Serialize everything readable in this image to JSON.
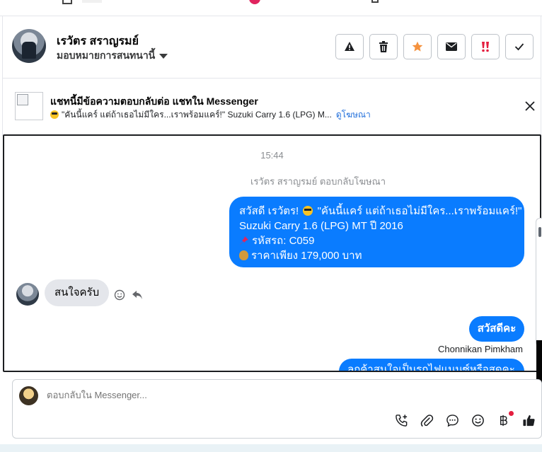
{
  "header": {
    "contact_name": "เรวัตร สราญรมย์",
    "assign_label": "มอบหมายการสนทนานี้",
    "actions": [
      {
        "icon": "warning-icon",
        "color": "#1c1e21"
      },
      {
        "icon": "trash-icon",
        "color": "#1c1e21"
      },
      {
        "icon": "star-icon",
        "color": "#f5923e"
      },
      {
        "icon": "envelope-icon",
        "color": "#1c1e21"
      },
      {
        "icon": "double-exclamation-icon",
        "color": "#e41e3f"
      },
      {
        "icon": "check-icon",
        "color": "#1c1e21"
      }
    ]
  },
  "ad": {
    "title": "แชทนี้มีข้อความตอบกลับต่อ แชทใน Messenger",
    "subtitle": "\"คันนี้แคร์ แต่ถ้าเธอไม่มีใคร...เราพร้อมแคร์!\" Suzuki Carry 1.6 (LPG) M...",
    "link_label": "ดูโฆษณา"
  },
  "conversation": {
    "timestamp": "15:44",
    "system_note": "เรวัตร สราญรมย์ ตอบกลับโฆษณา",
    "outgoing_ad_message": {
      "line1_prefix": "สวัสดี เรวัตร!",
      "line1_suffix": "\"คันนี้แคร์ แต่ถ้าเธอไม่มีใคร...เราพร้อมแคร์!\"",
      "line2": "Suzuki Carry 1.6 (LPG) MT ปี 2016",
      "line3": "รหัสรถ: C059",
      "line4": "ราคาเพียง 179,000 บาท"
    },
    "incoming_message": "สนใจครับ",
    "outgoing_greeting": "สวัสดีคะ",
    "sender_name": "Chonnikan Pimkham",
    "outgoing_partial": "ลูกค้าสนใจเป็นรถไฟแนนซ์หรือสดคะ",
    "bubble_color": "#0a7cff"
  },
  "composer": {
    "placeholder": "ตอบกลับใน Messenger...",
    "tools": [
      "phone-plus-icon",
      "paperclip-icon",
      "chat-bubble-icon",
      "emoji-icon",
      "baht-icon",
      "thumbs-up-icon"
    ]
  }
}
